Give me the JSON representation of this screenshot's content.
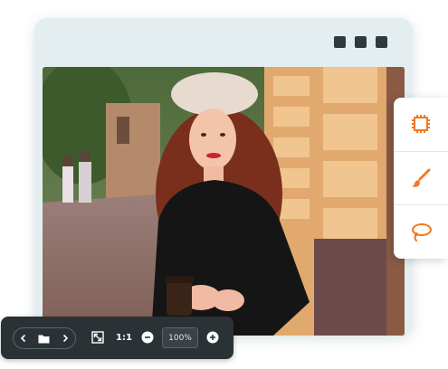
{
  "window": {
    "menu_dots": [
      "window-menu-dot",
      "window-menu-dot",
      "window-menu-dot"
    ]
  },
  "side_tools": [
    {
      "name": "crop-tool-icon",
      "color": "#f07a22"
    },
    {
      "name": "brush-tool-icon",
      "color": "#f07a22"
    },
    {
      "name": "lasso-tool-icon",
      "color": "#f07a22"
    }
  ],
  "bottom_toolbar": {
    "ratio_label": "1:1",
    "zoom_value": "100%",
    "icons": [
      "chevron-left-icon",
      "folder-icon",
      "chevron-right-icon",
      "fit-screen-icon",
      "zoom-out-icon",
      "zoom-in-icon"
    ]
  },
  "colors": {
    "accent": "#f07a22",
    "toolbar_bg": "#2b3236",
    "window_bg": "#e4eef0"
  }
}
